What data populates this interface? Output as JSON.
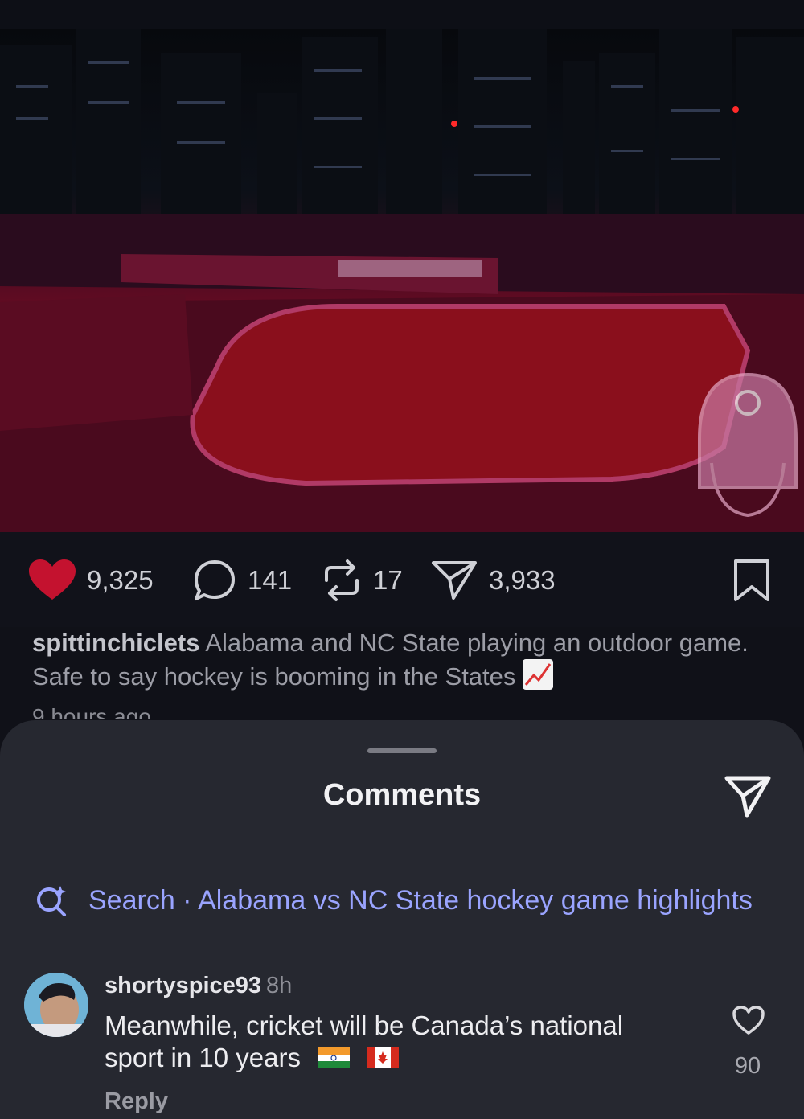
{
  "post": {
    "stats": {
      "likes": "9,325",
      "comments": "141",
      "reposts": "17",
      "shares": "3,933"
    },
    "caption_user": "spittinchiclets",
    "caption_text": "Alabama and NC State playing an outdoor game. Safe to say hockey is booming in the States",
    "caption_emoji": "chart-increasing",
    "time_ago": "9 hours ago"
  },
  "comments_sheet": {
    "title": "Comments",
    "search_text": "Search · Alabama vs NC State hockey game highlights",
    "comment": {
      "username": "shortyspice93",
      "time": "8h",
      "text": "Meanwhile, cricket will be Canada’s national sport in 10 years",
      "flags": [
        "india-flag",
        "canada-flag"
      ],
      "reply_label": "Reply",
      "like_count": "90"
    }
  },
  "colors": {
    "like_red": "#c4122f",
    "search_accent": "#9aa4ff",
    "sheet_bg": "#262830",
    "page_bg": "#101118"
  }
}
